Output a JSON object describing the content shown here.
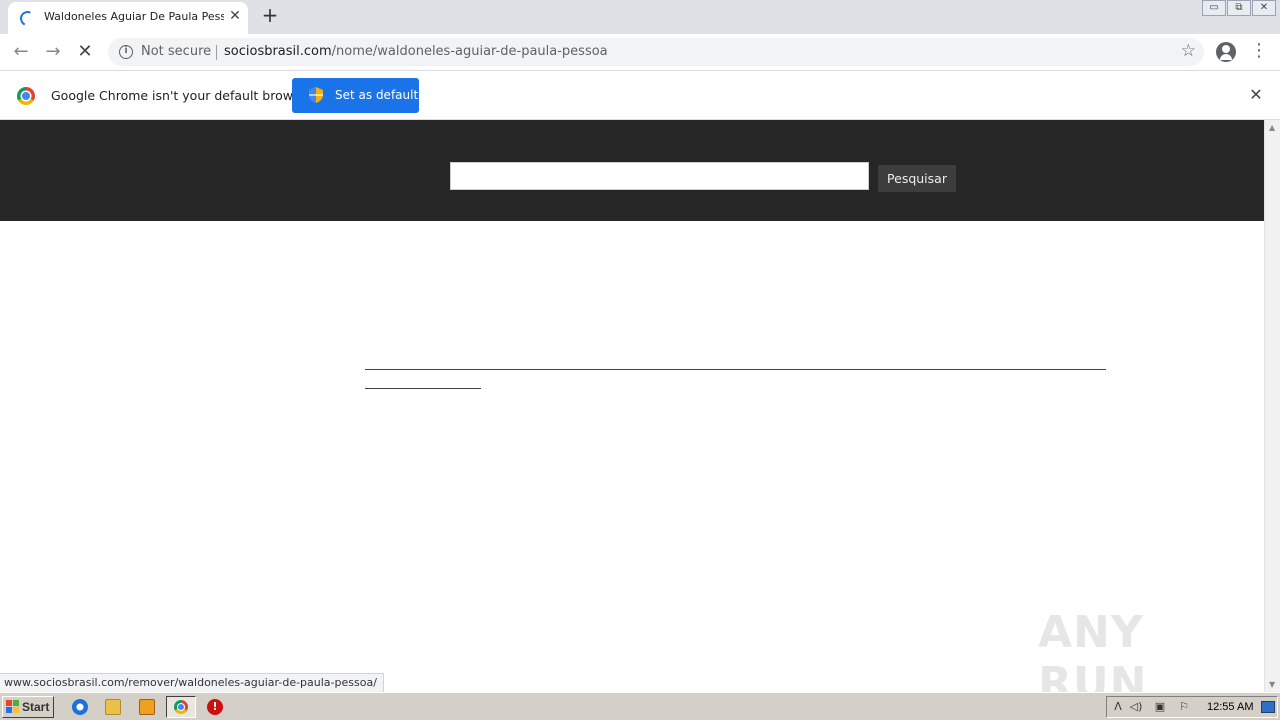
{
  "browser": {
    "tab_title": "Waldoneles Aguiar De Paula Pessoa",
    "tab_close_glyph": "✕",
    "new_tab_glyph": "+",
    "window_buttons": [
      "▭",
      "⧉",
      "✕"
    ],
    "nav": {
      "back_glyph": "←",
      "forward_glyph": "→",
      "stop_glyph": "✕"
    },
    "omnibox": {
      "security_label": "Not secure",
      "url_host": "sociosbrasil.com",
      "url_path": "/nome/waldoneles-aguiar-de-paula-pessoa"
    },
    "menu_glyph": "⋮",
    "star_glyph": "☆"
  },
  "infobar": {
    "message": "Google Chrome isn't your default browser",
    "button_label": "Set as default",
    "close_glyph": "✕"
  },
  "page": {
    "search_value": "",
    "search_button_label": "Pesquisar"
  },
  "status_url": "www.sociosbrasil.com/remover/waldoneles-aguiar-de-paula-pessoa/",
  "watermark": "ANY RUN",
  "taskbar": {
    "start_label": "Start",
    "clock": "12:55 AM",
    "stop_glyph": "!"
  },
  "colors": {
    "header_band": "#262626",
    "set_default_button": "#1a73e8",
    "search_button": "#3d3d3d"
  }
}
